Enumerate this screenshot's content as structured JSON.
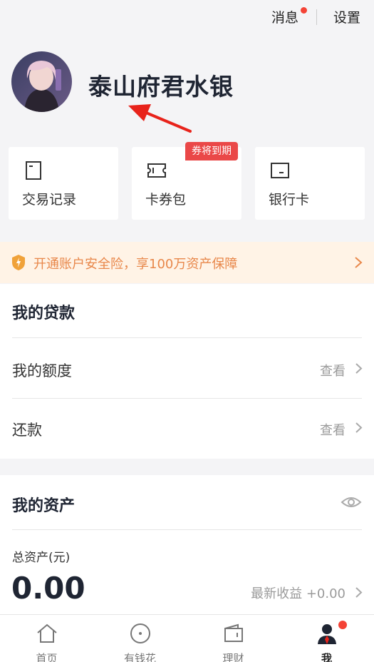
{
  "header": {
    "messages_label": "消息",
    "settings_label": "设置"
  },
  "profile": {
    "name": "泰山府君水银"
  },
  "quick_links": [
    {
      "label": "交易记录",
      "icon": "receipt-icon"
    },
    {
      "label": "卡券包",
      "icon": "ticket-icon",
      "badge": "券将到期"
    },
    {
      "label": "银行卡",
      "icon": "bank-card-icon"
    }
  ],
  "insurance_banner": {
    "text": "开通账户安全险，享100万资产保障",
    "icon": "shield-icon"
  },
  "loans": {
    "title": "我的贷款",
    "rows": [
      {
        "label": "我的额度",
        "action": "查看"
      },
      {
        "label": "还款",
        "action": "查看"
      }
    ]
  },
  "assets": {
    "title": "我的资产",
    "total_label": "总资产(元)",
    "total_value": "0.00",
    "latest_income": "最新收益 +0.00"
  },
  "tabbar": [
    {
      "label": "首页",
      "icon": "home-icon"
    },
    {
      "label": "有钱花",
      "icon": "coin-icon"
    },
    {
      "label": "理财",
      "icon": "wallet-icon"
    },
    {
      "label": "我",
      "icon": "user-icon",
      "active": true
    }
  ],
  "colors": {
    "accent_red": "#ea4848",
    "banner_orange": "#e8874a",
    "annotation_arrow": "#e8231b"
  }
}
